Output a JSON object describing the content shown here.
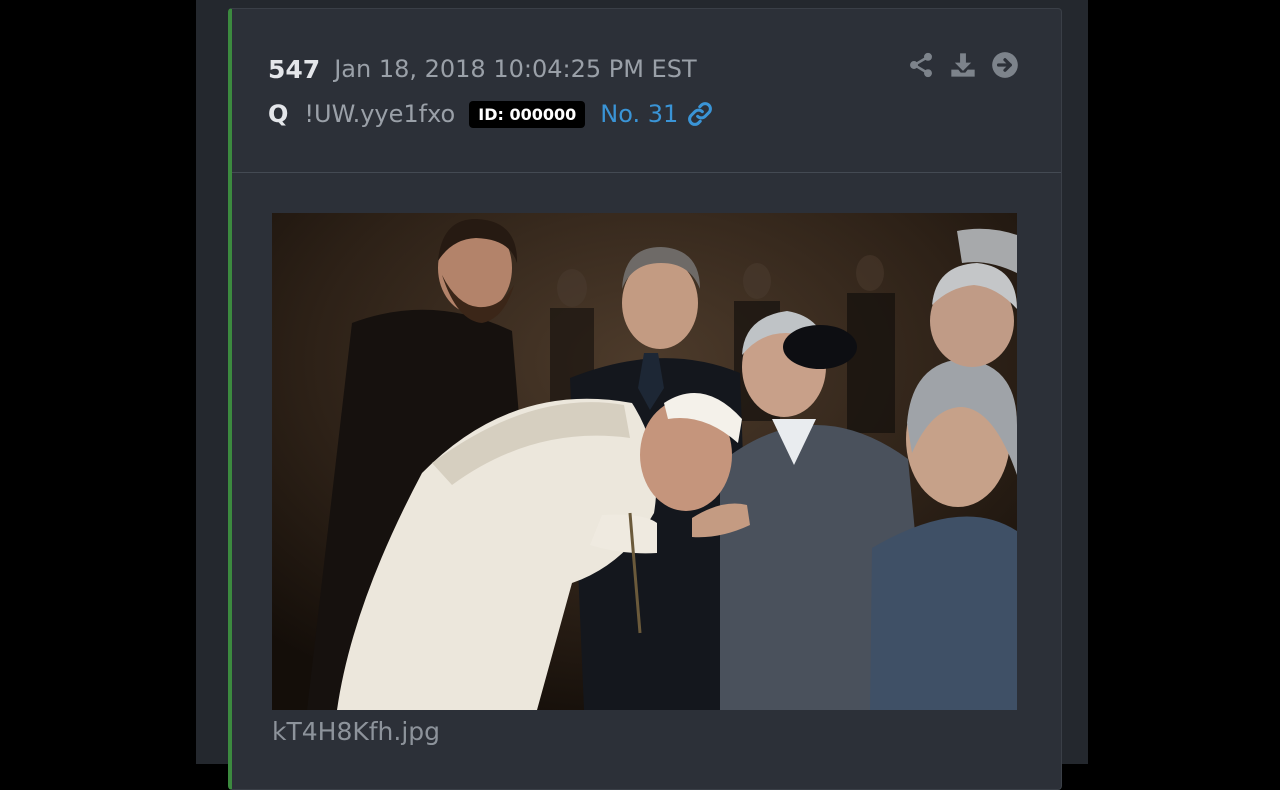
{
  "post": {
    "number": "547",
    "timestamp": "Jan 18, 2018 10:04:25 PM EST",
    "author": "Q",
    "tripcode": "!UW.yye1fxo",
    "id_badge": "ID: 000000",
    "post_no": "No. 31",
    "actions": [
      "share-icon",
      "download-icon",
      "arrow-right-circle-icon"
    ],
    "accent_color": "#3c8a3f",
    "link_color": "#3a94d6"
  },
  "attachment": {
    "filename": "kT4H8Kfh.jpg"
  }
}
